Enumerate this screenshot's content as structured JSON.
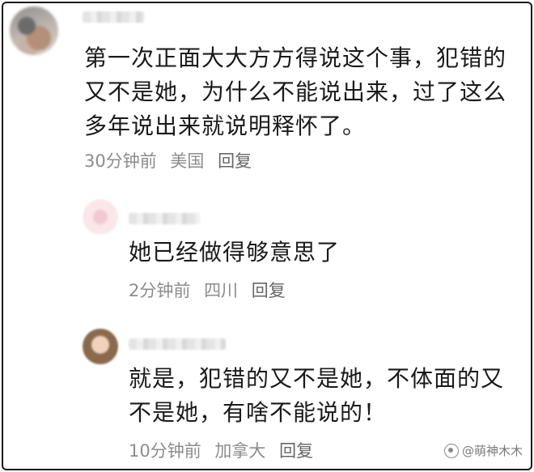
{
  "comments": [
    {
      "text": "第一次正面大大方方得说这个事，犯错的又不是她，为什么不能说出来，过了这么多年说出来就说明释怀了。",
      "time": "30分钟前",
      "location": "美国",
      "reply_label": "回复"
    },
    {
      "text": "她已经做得够意思了",
      "time": "2分钟前",
      "location": "四川",
      "reply_label": "回复"
    },
    {
      "text": "就是，犯错的又不是她，不体面的又不是她，有啥不能说的！",
      "time": "10分钟前",
      "location": "加拿大",
      "reply_label": "回复"
    }
  ],
  "watermark": {
    "text": "@萌神木木"
  },
  "colors": {
    "text": "#1a1a1a",
    "meta": "#8c8c8c",
    "border": "#1a1a1a"
  }
}
